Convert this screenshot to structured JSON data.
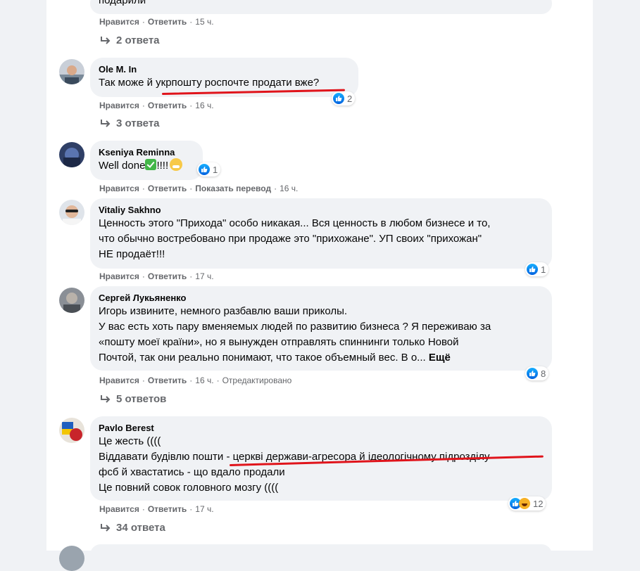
{
  "actions": {
    "like": "Нравится",
    "reply": "Ответить",
    "translate": "Показать перевод",
    "edited": "Отредактировано",
    "more": "Ещё"
  },
  "colors": {
    "bubble": "#f0f2f5",
    "meta": "#65676b",
    "like_blue": "#1877f2",
    "annotation_red": "#e0141b"
  },
  "comments": [
    {
      "author": "",
      "lines": [
        "подарили"
      ],
      "time": "15 ч.",
      "replies": "2 ответа"
    },
    {
      "author": "Ole M. In",
      "lines": [
        "Так може й укрпошту роспочте продати вже?"
      ],
      "time": "16 ч.",
      "reactions": "2",
      "replies": "3 ответа"
    },
    {
      "author": "Kseniya Reminna",
      "lines": [
        "Well done"
      ],
      "emoji_suffix": "!!!!",
      "time": "16 ч.",
      "reactions": "1"
    },
    {
      "author": "Vitaliy Sakhno",
      "lines": [
        "Ценность этого \"Прихода\" особо никакая... Вся ценность в любом бизнесе и то,",
        "что обычно востребовано при продаже это \"прихожане\". УП своих \"прихожан\"",
        "НЕ продаёт!!!"
      ],
      "time": "17 ч.",
      "reactions": "1"
    },
    {
      "author": "Сергей Лукьяненко",
      "lines": [
        "Игорь извините, немного разбавлю ваши приколы.",
        "У вас есть хоть пару вменяемых людей по развитию бизнеса ? Я переживаю за",
        "«пошту моеї країни», но я вынужден отправлять спиннинги только Новой",
        "Почтой, так они реально понимают, что такое объемный вес. В о..."
      ],
      "time": "16 ч.",
      "reactions": "8",
      "replies": "5 ответов"
    },
    {
      "author": "Pavlo Berest",
      "lines": [
        "Це жесть ((((",
        "Віддавати будівлю пошти - церкві держави-агресора й ідеологічному підрозділу",
        "фсб й хвастатись - що вдало продали",
        "Це повний совок головного мозгу (((("
      ],
      "time": "17 ч.",
      "reactions": "12",
      "replies": "34 ответа"
    }
  ]
}
